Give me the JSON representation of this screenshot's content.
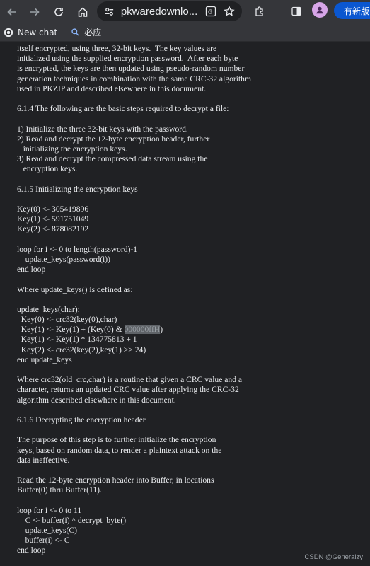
{
  "browser": {
    "url": "pkwaredownlo...",
    "update_label": "有新版"
  },
  "bookmarks": [
    {
      "label": "New chat",
      "icon": "chatgpt-icon"
    },
    {
      "label": "必应",
      "icon": "search-icon"
    }
  ],
  "document": {
    "lines": [
      "itself encrypted, using three, 32-bit keys.  The key values are",
      "initialized using the supplied encryption password.  After each byte",
      "is encrypted, the keys are then updated using pseudo-random number",
      "generation techniques in combination with the same CRC-32 algorithm",
      "used in PKZIP and described elsewhere in this document.",
      "",
      "6.1.4 The following are the basic steps required to decrypt a file:",
      "",
      "1) Initialize the three 32-bit keys with the password.",
      "2) Read and decrypt the 12-byte encryption header, further",
      "   initializing the encryption keys.",
      "3) Read and decrypt the compressed data stream using the",
      "   encryption keys.",
      "",
      "6.1.5 Initializing the encryption keys",
      "",
      "Key(0) <- 305419896",
      "Key(1) <- 591751049",
      "Key(2) <- 878082192",
      "",
      "loop for i <- 0 to length(password)-1",
      "    update_keys(password(i))",
      "end loop",
      "",
      "Where update_keys() is defined as:",
      "",
      "update_keys(char):",
      "  Key(0) <- crc32(key(0),char)",
      "  Key(1) <- Key(1) + (Key(0) & 000000ffH)",
      "  Key(1) <- Key(1) * 134775813 + 1",
      "  Key(2) <- crc32(key(2),key(1) >> 24)",
      "end update_keys",
      "",
      "Where crc32(old_crc,char) is a routine that given a CRC value and a",
      "character, returns an updated CRC value after applying the CRC-32",
      "algorithm described elsewhere in this document.",
      "",
      "6.1.6 Decrypting the encryption header",
      "",
      "The purpose of this step is to further initialize the encryption",
      "keys, based on random data, to render a plaintext attack on the",
      "data ineffective.",
      "",
      "Read the 12-byte encryption header into Buffer, in locations",
      "Buffer(0) thru Buffer(11).",
      "",
      "loop for i <- 0 to 11",
      "    C <- buffer(i) ^ decrypt_byte()",
      "    update_keys(C)",
      "    buffer(i) <- C",
      "end loop"
    ],
    "highlight": {
      "line_index": 28,
      "before": "  Key(1) <- Key(1) + (Key(0) & ",
      "text": "000000ffH",
      "after": ")"
    }
  },
  "watermark": "CSDN @Generalzy"
}
